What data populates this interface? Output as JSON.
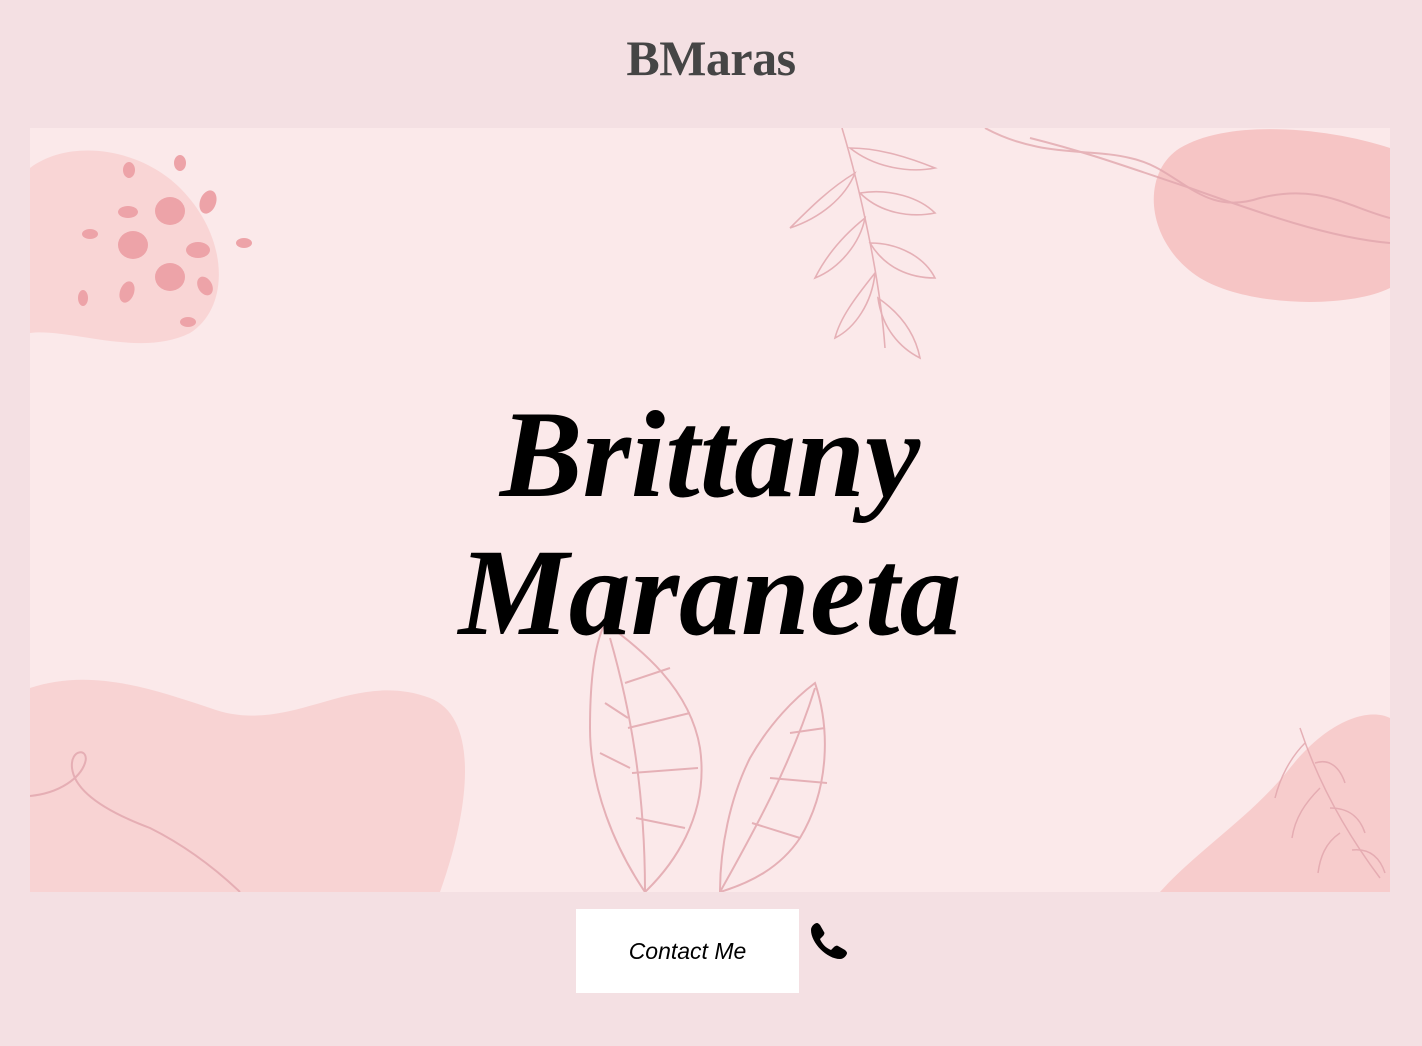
{
  "header": {
    "brand": "BMaras"
  },
  "hero": {
    "first_name": "Brittany",
    "last_name": "Maraneta"
  },
  "contact": {
    "button_label": "Contact Me",
    "icon": "phone-icon"
  },
  "colors": {
    "page_background": "#f4e0e3",
    "hero_background": "#fbe9ea",
    "blob": "#f6c9c9",
    "line_art": "#e2a7ae",
    "brand_text": "#454545"
  }
}
